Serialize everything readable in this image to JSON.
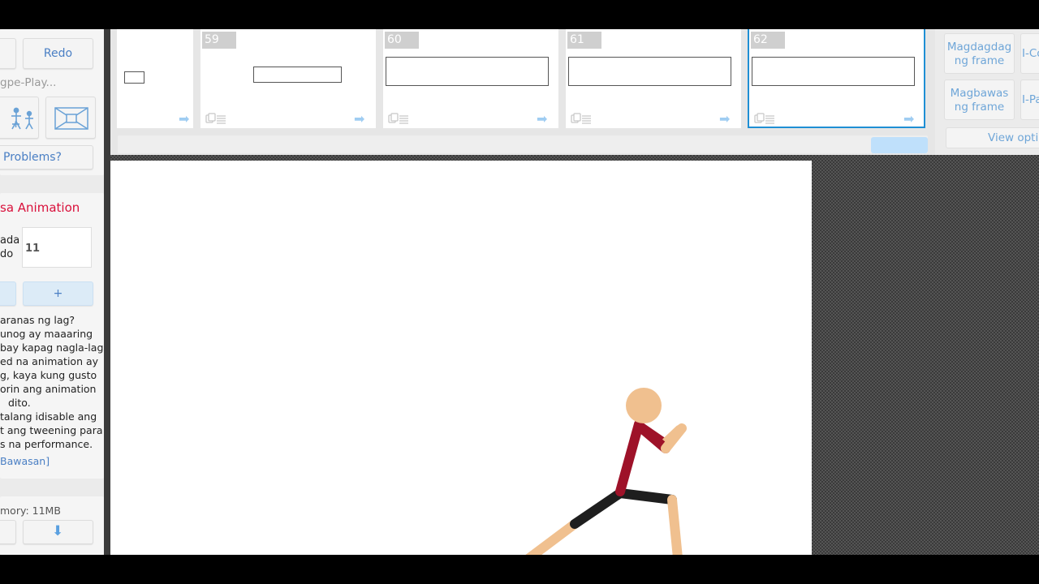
{
  "toolbar": {
    "redo_label": "Redo",
    "autoplay_label": "gpe-Play...",
    "problems_label": "Problems?"
  },
  "animation_section": {
    "title": "sa Animation",
    "fps_label_line1": "ada",
    "fps_label_line2": "do",
    "fps_value": "11",
    "plus_label": "+",
    "lag_text": [
      "aranas ng lag?",
      "unog ay maaaring",
      "bay kapag nagla-lag.",
      "ed na animation ay",
      "g, kaya kung gusto",
      "orin ang animation",
      "dito.",
      "talang idisable ang",
      "t ang tweening para",
      "s na performance."
    ],
    "reduce_link": "Bawasan]"
  },
  "memory": {
    "label": "mory: 11MB"
  },
  "timeline": {
    "frames": [
      {
        "number": ""
      },
      {
        "number": "59"
      },
      {
        "number": "60"
      },
      {
        "number": "61"
      },
      {
        "number": "62",
        "selected": true
      }
    ],
    "arrow_glyph": "➡"
  },
  "right_panel": {
    "add_frame": "Magdagdag ng frame",
    "remove_frame": "Magbawas ng frame",
    "copy_label": "I-Co",
    "paste_label": "I-Pa",
    "view_options": "View optio"
  },
  "colors": {
    "link_blue": "#4a7fc4",
    "title_red": "#d9103b",
    "shirt_red": "#9e1229",
    "skin": "#f0c08f",
    "pants": "#1e1e1e",
    "selected_border": "#1f8fd4"
  },
  "icons": [
    "stick-figures-icon",
    "stage-size-icon",
    "down-arrow-icon",
    "right-arrow-icon",
    "frame-copy-icon"
  ]
}
